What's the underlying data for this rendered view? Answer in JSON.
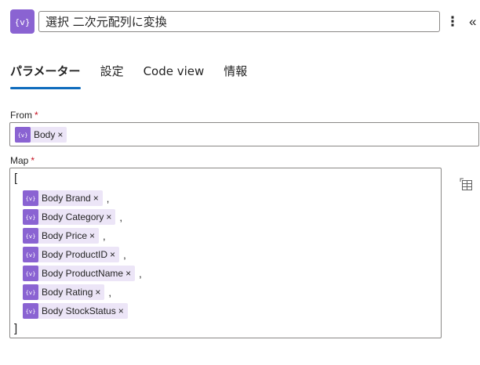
{
  "header": {
    "title": "選択 二次元配列に変換",
    "icon": "expression-icon",
    "more_icon": "more-vertical-icon",
    "collapse_icon": "collapse-chevrons-icon"
  },
  "tabs": [
    {
      "label": "パラメーター",
      "active": true
    },
    {
      "label": "設定",
      "active": false
    },
    {
      "label": "Code view",
      "active": false
    },
    {
      "label": "情報",
      "active": false
    }
  ],
  "from": {
    "label": "From",
    "required_mark": "*",
    "tokens": [
      {
        "label": "Body",
        "remove": "×"
      }
    ]
  },
  "map": {
    "label": "Map",
    "required_mark": "*",
    "open_bracket": "[",
    "close_bracket": "]",
    "comma": ",",
    "tokens": [
      {
        "label": "Body Brand",
        "remove": "×"
      },
      {
        "label": "Body Category",
        "remove": "×"
      },
      {
        "label": "Body Price",
        "remove": "×"
      },
      {
        "label": "Body ProductID",
        "remove": "×"
      },
      {
        "label": "Body ProductName",
        "remove": "×"
      },
      {
        "label": "Body Rating",
        "remove": "×"
      },
      {
        "label": "Body StockStatus",
        "remove": "×"
      }
    ],
    "side_icon": "switch-to-table-icon"
  },
  "colors": {
    "accent_purple": "#8a63d2",
    "token_bg": "#ece5f7",
    "tab_underline": "#0f6cbd",
    "required_red": "#c50f1f"
  }
}
